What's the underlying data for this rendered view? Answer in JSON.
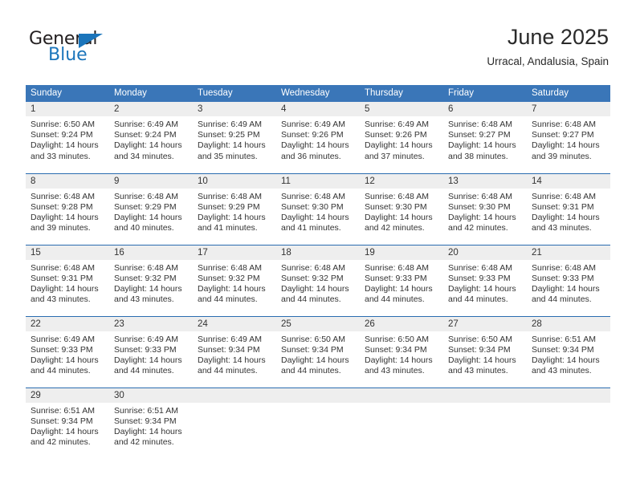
{
  "logo": {
    "word1": "General",
    "word2": "Blue",
    "triangle_color": "#1b75bb",
    "text_color": "#231f20"
  },
  "header": {
    "title": "June 2025",
    "subtitle": "Urracal, Andalusia, Spain"
  },
  "colors": {
    "header_bg": "#3a76b8",
    "daynum_bg": "#eeeeee",
    "week_separator": "#2a6cb0",
    "text": "#333333"
  },
  "calendar": {
    "weekday_headers": [
      "Sunday",
      "Monday",
      "Tuesday",
      "Wednesday",
      "Thursday",
      "Friday",
      "Saturday"
    ],
    "weeks": [
      [
        {
          "day": "1",
          "sunrise": "Sunrise: 6:50 AM",
          "sunset": "Sunset: 9:24 PM",
          "daylight1": "Daylight: 14 hours",
          "daylight2": "and 33 minutes."
        },
        {
          "day": "2",
          "sunrise": "Sunrise: 6:49 AM",
          "sunset": "Sunset: 9:24 PM",
          "daylight1": "Daylight: 14 hours",
          "daylight2": "and 34 minutes."
        },
        {
          "day": "3",
          "sunrise": "Sunrise: 6:49 AM",
          "sunset": "Sunset: 9:25 PM",
          "daylight1": "Daylight: 14 hours",
          "daylight2": "and 35 minutes."
        },
        {
          "day": "4",
          "sunrise": "Sunrise: 6:49 AM",
          "sunset": "Sunset: 9:26 PM",
          "daylight1": "Daylight: 14 hours",
          "daylight2": "and 36 minutes."
        },
        {
          "day": "5",
          "sunrise": "Sunrise: 6:49 AM",
          "sunset": "Sunset: 9:26 PM",
          "daylight1": "Daylight: 14 hours",
          "daylight2": "and 37 minutes."
        },
        {
          "day": "6",
          "sunrise": "Sunrise: 6:48 AM",
          "sunset": "Sunset: 9:27 PM",
          "daylight1": "Daylight: 14 hours",
          "daylight2": "and 38 minutes."
        },
        {
          "day": "7",
          "sunrise": "Sunrise: 6:48 AM",
          "sunset": "Sunset: 9:27 PM",
          "daylight1": "Daylight: 14 hours",
          "daylight2": "and 39 minutes."
        }
      ],
      [
        {
          "day": "8",
          "sunrise": "Sunrise: 6:48 AM",
          "sunset": "Sunset: 9:28 PM",
          "daylight1": "Daylight: 14 hours",
          "daylight2": "and 39 minutes."
        },
        {
          "day": "9",
          "sunrise": "Sunrise: 6:48 AM",
          "sunset": "Sunset: 9:29 PM",
          "daylight1": "Daylight: 14 hours",
          "daylight2": "and 40 minutes."
        },
        {
          "day": "10",
          "sunrise": "Sunrise: 6:48 AM",
          "sunset": "Sunset: 9:29 PM",
          "daylight1": "Daylight: 14 hours",
          "daylight2": "and 41 minutes."
        },
        {
          "day": "11",
          "sunrise": "Sunrise: 6:48 AM",
          "sunset": "Sunset: 9:30 PM",
          "daylight1": "Daylight: 14 hours",
          "daylight2": "and 41 minutes."
        },
        {
          "day": "12",
          "sunrise": "Sunrise: 6:48 AM",
          "sunset": "Sunset: 9:30 PM",
          "daylight1": "Daylight: 14 hours",
          "daylight2": "and 42 minutes."
        },
        {
          "day": "13",
          "sunrise": "Sunrise: 6:48 AM",
          "sunset": "Sunset: 9:30 PM",
          "daylight1": "Daylight: 14 hours",
          "daylight2": "and 42 minutes."
        },
        {
          "day": "14",
          "sunrise": "Sunrise: 6:48 AM",
          "sunset": "Sunset: 9:31 PM",
          "daylight1": "Daylight: 14 hours",
          "daylight2": "and 43 minutes."
        }
      ],
      [
        {
          "day": "15",
          "sunrise": "Sunrise: 6:48 AM",
          "sunset": "Sunset: 9:31 PM",
          "daylight1": "Daylight: 14 hours",
          "daylight2": "and 43 minutes."
        },
        {
          "day": "16",
          "sunrise": "Sunrise: 6:48 AM",
          "sunset": "Sunset: 9:32 PM",
          "daylight1": "Daylight: 14 hours",
          "daylight2": "and 43 minutes."
        },
        {
          "day": "17",
          "sunrise": "Sunrise: 6:48 AM",
          "sunset": "Sunset: 9:32 PM",
          "daylight1": "Daylight: 14 hours",
          "daylight2": "and 44 minutes."
        },
        {
          "day": "18",
          "sunrise": "Sunrise: 6:48 AM",
          "sunset": "Sunset: 9:32 PM",
          "daylight1": "Daylight: 14 hours",
          "daylight2": "and 44 minutes."
        },
        {
          "day": "19",
          "sunrise": "Sunrise: 6:48 AM",
          "sunset": "Sunset: 9:33 PM",
          "daylight1": "Daylight: 14 hours",
          "daylight2": "and 44 minutes."
        },
        {
          "day": "20",
          "sunrise": "Sunrise: 6:48 AM",
          "sunset": "Sunset: 9:33 PM",
          "daylight1": "Daylight: 14 hours",
          "daylight2": "and 44 minutes."
        },
        {
          "day": "21",
          "sunrise": "Sunrise: 6:48 AM",
          "sunset": "Sunset: 9:33 PM",
          "daylight1": "Daylight: 14 hours",
          "daylight2": "and 44 minutes."
        }
      ],
      [
        {
          "day": "22",
          "sunrise": "Sunrise: 6:49 AM",
          "sunset": "Sunset: 9:33 PM",
          "daylight1": "Daylight: 14 hours",
          "daylight2": "and 44 minutes."
        },
        {
          "day": "23",
          "sunrise": "Sunrise: 6:49 AM",
          "sunset": "Sunset: 9:33 PM",
          "daylight1": "Daylight: 14 hours",
          "daylight2": "and 44 minutes."
        },
        {
          "day": "24",
          "sunrise": "Sunrise: 6:49 AM",
          "sunset": "Sunset: 9:34 PM",
          "daylight1": "Daylight: 14 hours",
          "daylight2": "and 44 minutes."
        },
        {
          "day": "25",
          "sunrise": "Sunrise: 6:50 AM",
          "sunset": "Sunset: 9:34 PM",
          "daylight1": "Daylight: 14 hours",
          "daylight2": "and 44 minutes."
        },
        {
          "day": "26",
          "sunrise": "Sunrise: 6:50 AM",
          "sunset": "Sunset: 9:34 PM",
          "daylight1": "Daylight: 14 hours",
          "daylight2": "and 43 minutes."
        },
        {
          "day": "27",
          "sunrise": "Sunrise: 6:50 AM",
          "sunset": "Sunset: 9:34 PM",
          "daylight1": "Daylight: 14 hours",
          "daylight2": "and 43 minutes."
        },
        {
          "day": "28",
          "sunrise": "Sunrise: 6:51 AM",
          "sunset": "Sunset: 9:34 PM",
          "daylight1": "Daylight: 14 hours",
          "daylight2": "and 43 minutes."
        }
      ],
      [
        {
          "day": "29",
          "sunrise": "Sunrise: 6:51 AM",
          "sunset": "Sunset: 9:34 PM",
          "daylight1": "Daylight: 14 hours",
          "daylight2": "and 42 minutes."
        },
        {
          "day": "30",
          "sunrise": "Sunrise: 6:51 AM",
          "sunset": "Sunset: 9:34 PM",
          "daylight1": "Daylight: 14 hours",
          "daylight2": "and 42 minutes."
        },
        {
          "day": "",
          "sunrise": "",
          "sunset": "",
          "daylight1": "",
          "daylight2": ""
        },
        {
          "day": "",
          "sunrise": "",
          "sunset": "",
          "daylight1": "",
          "daylight2": ""
        },
        {
          "day": "",
          "sunrise": "",
          "sunset": "",
          "daylight1": "",
          "daylight2": ""
        },
        {
          "day": "",
          "sunrise": "",
          "sunset": "",
          "daylight1": "",
          "daylight2": ""
        },
        {
          "day": "",
          "sunrise": "",
          "sunset": "",
          "daylight1": "",
          "daylight2": ""
        }
      ]
    ]
  }
}
